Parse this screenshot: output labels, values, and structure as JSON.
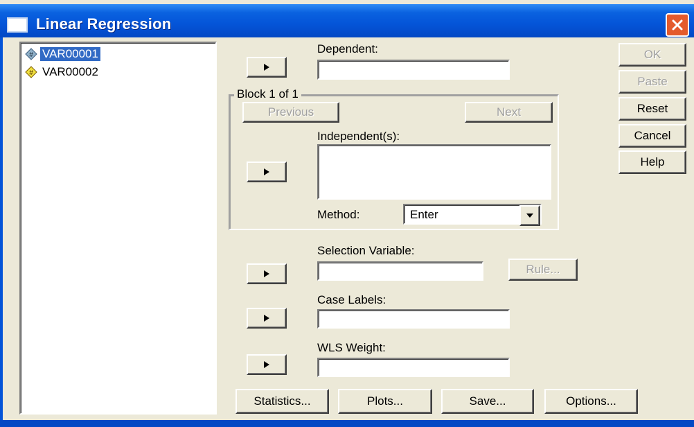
{
  "window": {
    "title": "Linear Regression"
  },
  "variables": [
    {
      "name": "VAR00001",
      "selected": true,
      "icon": "numeric-scale-variable-icon"
    },
    {
      "name": "VAR00002",
      "selected": false,
      "icon": "numeric-variable-icon"
    }
  ],
  "dependent": {
    "label": "Dependent:",
    "value": ""
  },
  "block": {
    "legend": "Block 1 of 1",
    "previous_label": "Previous",
    "next_label": "Next",
    "independents_label": "Independent(s):",
    "method_label": "Method:",
    "method_value": "Enter"
  },
  "selection": {
    "label": "Selection Variable:",
    "value": "",
    "rule_label": "Rule..."
  },
  "case_labels": {
    "label": "Case Labels:",
    "value": ""
  },
  "wls": {
    "label": "WLS Weight:",
    "value": ""
  },
  "side_buttons": {
    "ok": "OK",
    "paste": "Paste",
    "reset": "Reset",
    "cancel": "Cancel",
    "help": "Help"
  },
  "bottom_buttons": {
    "statistics": "Statistics...",
    "plots": "Plots...",
    "save": "Save...",
    "options": "Options..."
  },
  "colors": {
    "titlebar": "#0454d8",
    "selection": "#316ac5",
    "close": "#e45a2c",
    "dialog_bg": "#ece9d8"
  }
}
